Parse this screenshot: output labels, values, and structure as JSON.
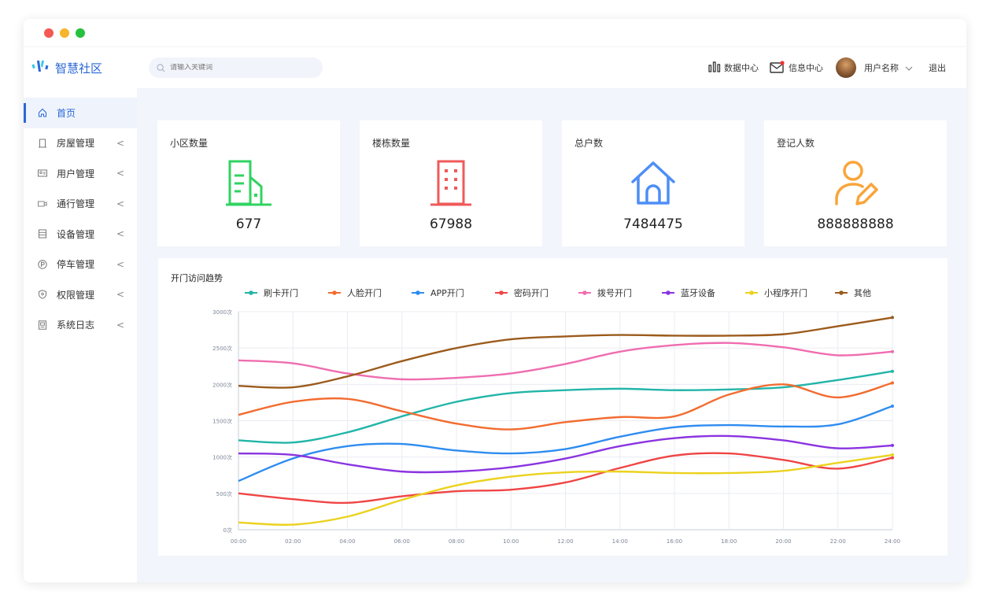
{
  "window": {
    "dots": [
      "#f25a53",
      "#f6b52e",
      "#27c13f"
    ]
  },
  "brand": {
    "name": "智慧社区"
  },
  "search": {
    "placeholder": "请输入关键词"
  },
  "header": {
    "data_center": "数据中心",
    "message_center": "信息中心",
    "user_name": "用户名称",
    "logout": "退出"
  },
  "sidebar": {
    "items": [
      {
        "label": "首页",
        "icon": "home-icon",
        "active": true
      },
      {
        "label": "房屋管理",
        "icon": "building-icon"
      },
      {
        "label": "用户管理",
        "icon": "user-card-icon"
      },
      {
        "label": "通行管理",
        "icon": "camera-icon"
      },
      {
        "label": "设备管理",
        "icon": "device-icon"
      },
      {
        "label": "停车管理",
        "icon": "parking-icon"
      },
      {
        "label": "权限管理",
        "icon": "shield-icon"
      },
      {
        "label": "系统日志",
        "icon": "log-icon"
      }
    ],
    "arrow": "<"
  },
  "stats": [
    {
      "title": "小区数量",
      "value": "677",
      "icon": "community-building-icon",
      "color": "#2fd360"
    },
    {
      "title": "楼栋数量",
      "value": "67988",
      "icon": "tower-icon",
      "color": "#ef5a5a"
    },
    {
      "title": "总户数",
      "value": "7484475",
      "icon": "house-icon",
      "color": "#4d8ef7"
    },
    {
      "title": "登记人数",
      "value": "888888888",
      "icon": "person-edit-icon",
      "color": "#f9a53a"
    }
  ],
  "chart_data": {
    "type": "line",
    "title": "开门访问趋势",
    "x": [
      "00:00",
      "02:00",
      "04:00",
      "06:00",
      "08:00",
      "10:00",
      "12:00",
      "14:00",
      "16:00",
      "18:00",
      "20:00",
      "22:00",
      "24:00"
    ],
    "ylim": [
      0,
      3000
    ],
    "yticks": [
      "0次",
      "500次",
      "1000次",
      "1500次",
      "2000次",
      "2500次",
      "3000次"
    ],
    "grid": true,
    "legend_position": "top",
    "series": [
      {
        "name": "刷卡开门",
        "color": "#22b5a8",
        "values": [
          1230,
          1200,
          1340,
          1560,
          1760,
          1880,
          1920,
          1940,
          1920,
          1930,
          1960,
          2060,
          2180
        ]
      },
      {
        "name": "人脸开门",
        "color": "#f26c30",
        "values": [
          1580,
          1760,
          1800,
          1630,
          1460,
          1380,
          1480,
          1550,
          1560,
          1860,
          2000,
          1820,
          2020
        ]
      },
      {
        "name": "APP开门",
        "color": "#2f8cf0",
        "values": [
          670,
          980,
          1150,
          1180,
          1090,
          1050,
          1110,
          1280,
          1410,
          1440,
          1420,
          1450,
          1700
        ]
      },
      {
        "name": "密码开门",
        "color": "#ef4545",
        "values": [
          500,
          420,
          370,
          460,
          530,
          550,
          650,
          850,
          1020,
          1050,
          960,
          840,
          990
        ]
      },
      {
        "name": "拨号开门",
        "color": "#ef6db0",
        "values": [
          2330,
          2290,
          2150,
          2070,
          2090,
          2150,
          2280,
          2450,
          2540,
          2570,
          2510,
          2400,
          2450
        ]
      },
      {
        "name": "蓝牙设备",
        "color": "#8a34e0",
        "values": [
          1050,
          1030,
          900,
          800,
          800,
          860,
          980,
          1150,
          1260,
          1290,
          1230,
          1120,
          1160
        ]
      },
      {
        "name": "小程序开门",
        "color": "#ebd21e",
        "values": [
          100,
          70,
          180,
          410,
          610,
          730,
          790,
          800,
          780,
          780,
          810,
          920,
          1030
        ]
      },
      {
        "name": "其他",
        "color": "#9b5b1c",
        "values": [
          1980,
          1960,
          2110,
          2320,
          2500,
          2620,
          2660,
          2680,
          2670,
          2670,
          2690,
          2800,
          2920
        ]
      }
    ]
  }
}
